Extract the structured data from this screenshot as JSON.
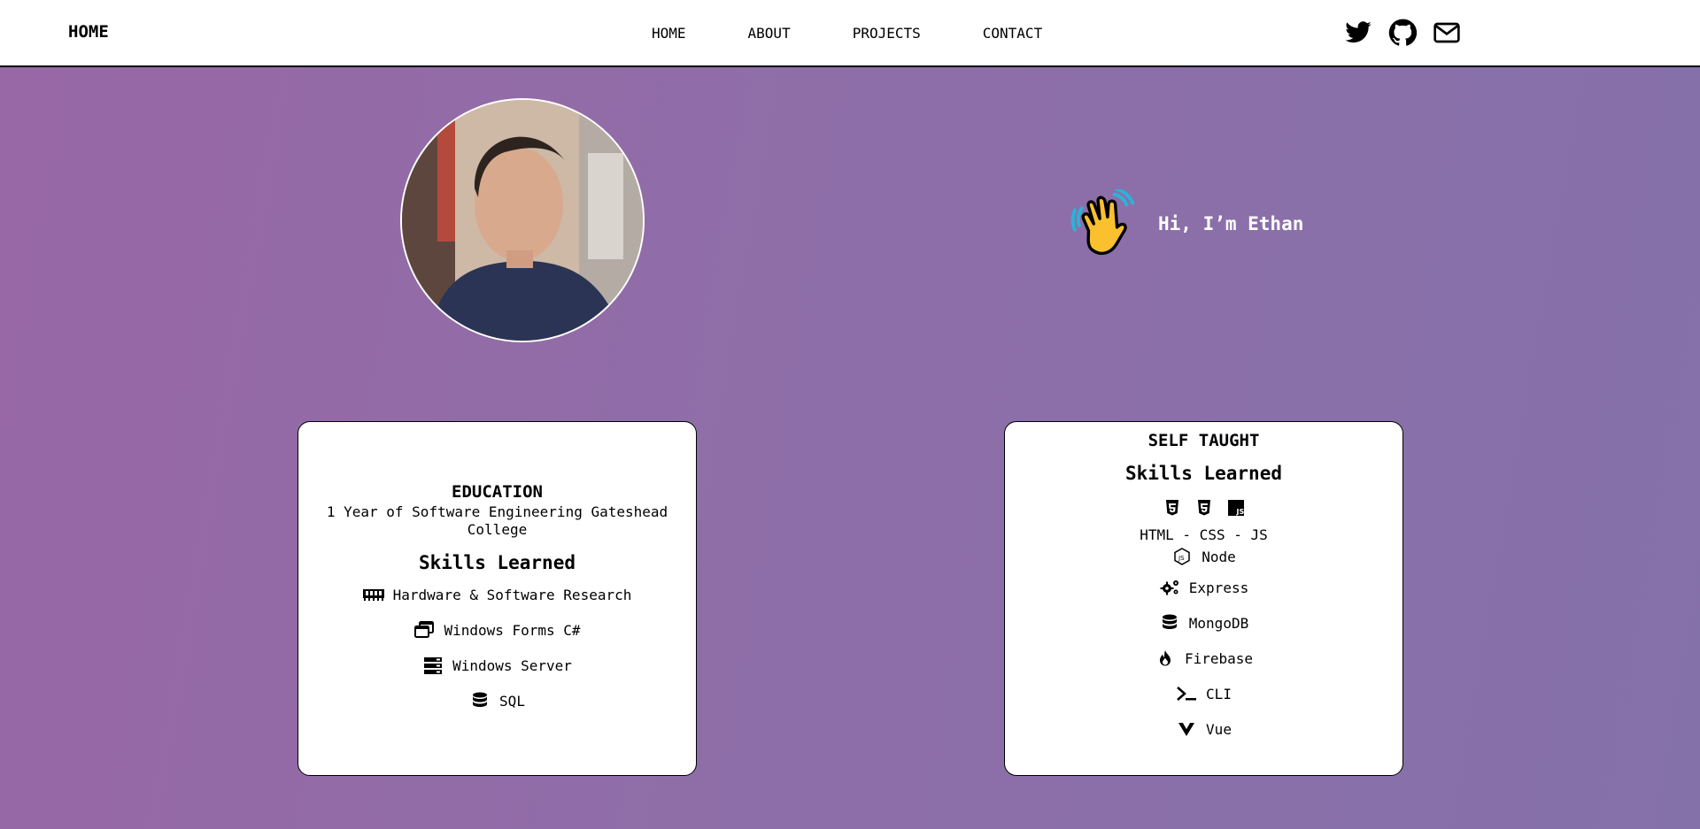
{
  "navbar": {
    "brand": "HOME",
    "links": [
      "HOME",
      "ABOUT",
      "PROJECTS",
      "CONTACT"
    ],
    "social_icons": [
      "twitter-icon",
      "github-icon",
      "mail-icon"
    ]
  },
  "hero": {
    "greeting": "Hi, I’m Ethan",
    "wave_icon": "waving-hand-icon"
  },
  "education": {
    "title": "EDUCATION",
    "subtitle": "1 Year of Software Engineering Gateshead College",
    "skills_title": "Skills Learned",
    "skills": [
      {
        "label": "Hardware & Software Research",
        "icon": "memory-icon"
      },
      {
        "label": "Windows Forms C#",
        "icon": "windows-icon"
      },
      {
        "label": "Windows Server",
        "icon": "server-icon"
      },
      {
        "label": "SQL",
        "icon": "database-icon"
      }
    ]
  },
  "self_taught": {
    "title": "SELF TAUGHT",
    "skills_title": "Skills Learned",
    "tech_icons": [
      "html5-icon",
      "css3-icon",
      "js-icon"
    ],
    "tech_line": "HTML - CSS - JS",
    "skills": [
      {
        "label": "Node",
        "icon": "node-icon"
      },
      {
        "label": "Express",
        "icon": "gears-icon"
      },
      {
        "label": "MongoDB",
        "icon": "database-icon"
      },
      {
        "label": "Firebase",
        "icon": "fire-icon"
      },
      {
        "label": "CLI",
        "icon": "terminal-icon"
      },
      {
        "label": "Vue",
        "icon": "vue-icon"
      }
    ]
  },
  "colors": {
    "background_start": "#9867a5",
    "background_end": "#8571aa",
    "navbar_bg": "#ffffff",
    "card_bg": "#ffffff",
    "text": "#000000",
    "greeting_text": "#ffffff"
  }
}
